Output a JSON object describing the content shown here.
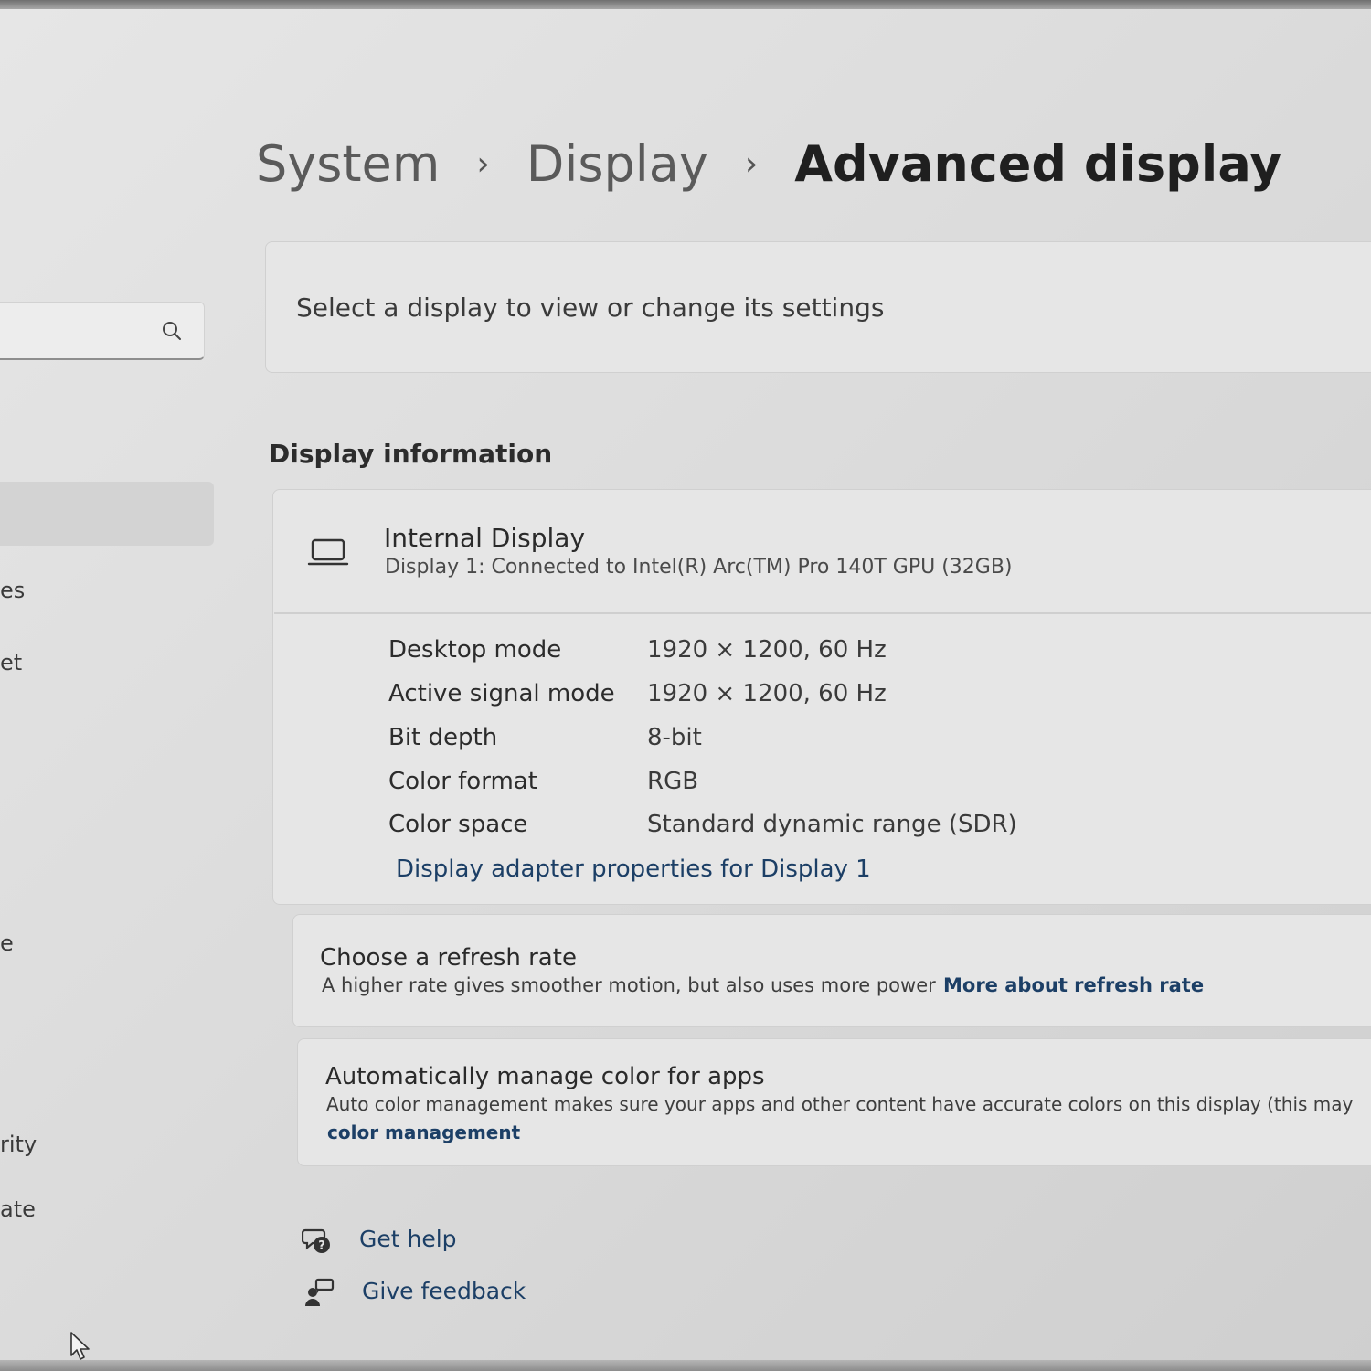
{
  "breadcrumb": {
    "items": [
      "System",
      "Display"
    ],
    "current": "Advanced display",
    "separator": "›"
  },
  "sidebar": {
    "labels": [
      "es",
      "et",
      "e",
      "rity",
      "ate"
    ]
  },
  "select_card": {
    "text": "Select a display to view or change its settings"
  },
  "display_info": {
    "heading": "Display information",
    "display_name": "Internal Display",
    "display_subtitle": "Display 1: Connected to Intel(R) Arc(TM) Pro 140T GPU (32GB)",
    "properties": [
      {
        "label": "Desktop mode",
        "value": "1920 × 1200, 60 Hz"
      },
      {
        "label": "Active signal mode",
        "value": "1920 × 1200, 60 Hz"
      },
      {
        "label": "Bit depth",
        "value": "8-bit"
      },
      {
        "label": "Color format",
        "value": "RGB"
      },
      {
        "label": "Color space",
        "value": "Standard dynamic range (SDR)"
      }
    ],
    "adapter_link": "Display adapter properties for Display 1"
  },
  "refresh": {
    "title": "Choose a refresh rate",
    "description": "A higher rate gives smoother motion, but also uses more power",
    "link": "More about refresh rate"
  },
  "color": {
    "title": "Automatically manage color for apps",
    "description": "Auto color management makes sure your apps and other content have accurate colors on this display (this may",
    "link": "color management"
  },
  "footer": {
    "get_help": "Get help",
    "give_feedback": "Give feedback"
  },
  "colors": {
    "link": "#1c3f66",
    "card": "#e6e6e6",
    "background": "#dcdcdc"
  }
}
